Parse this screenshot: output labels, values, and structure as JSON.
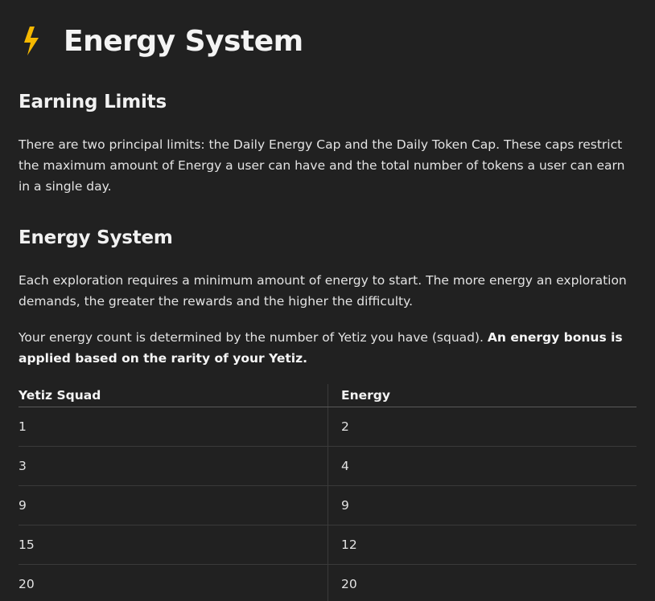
{
  "page": {
    "icon": "lightning-bolt-icon",
    "title": "Energy System",
    "accent_color": "#f5b800"
  },
  "earning_limits": {
    "heading": "Earning Limits",
    "paragraph": "There are two principal limits: the Daily Energy Cap and the Daily Token Cap. These caps restrict the maximum amount of Energy a user can have and the total number of tokens a user can earn in a single day."
  },
  "energy_system": {
    "heading": "Energy System",
    "paragraph1": "Each exploration requires a minimum amount of energy to start. The more energy an exploration demands, the greater the rewards and the higher the difficulty.",
    "paragraph2_plain": "Your energy count is determined by the number of Yetiz you have (squad). ",
    "paragraph2_bold": "An energy bonus is applied based on the rarity of your Yetiz."
  },
  "table": {
    "headers": [
      "Yetiz Squad",
      "Energy"
    ],
    "rows": [
      [
        "1",
        "2"
      ],
      [
        "3",
        "4"
      ],
      [
        "9",
        "9"
      ],
      [
        "15",
        "12"
      ],
      [
        "20",
        "20"
      ]
    ]
  }
}
